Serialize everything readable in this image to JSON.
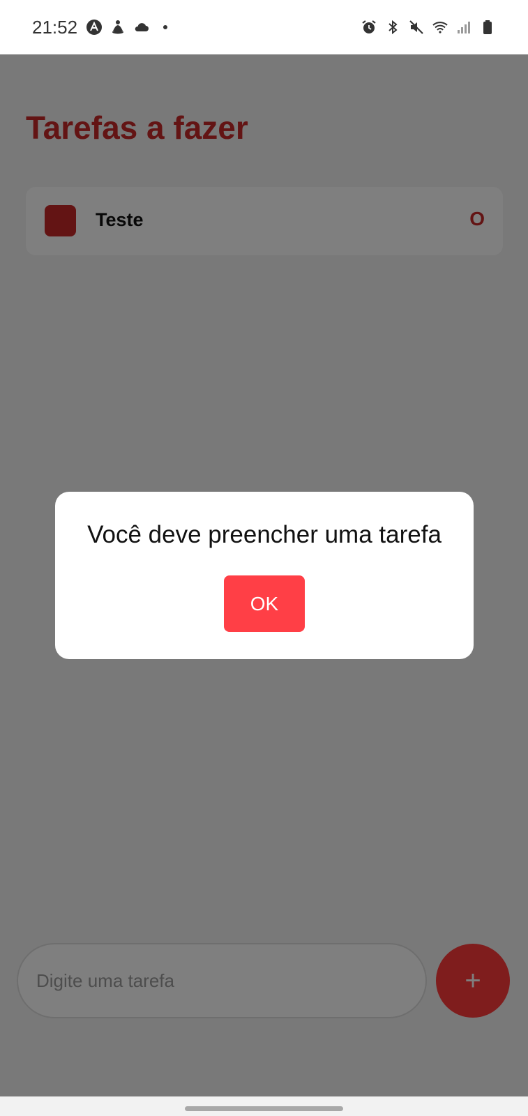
{
  "status_bar": {
    "time": "21:52",
    "left_icons": [
      "app-a-icon",
      "meditation-icon",
      "cloud-icon",
      "dot-icon"
    ],
    "right_icons": [
      "alarm-icon",
      "bluetooth-icon",
      "mute-icon",
      "wifi-icon",
      "signal-icon",
      "battery-icon"
    ]
  },
  "header": {
    "title": "Tarefas a fazer"
  },
  "tasks": [
    {
      "label": "Teste",
      "delete_label": "O"
    }
  ],
  "input": {
    "placeholder": "Digite uma tarefa",
    "value": ""
  },
  "add_button": {
    "label": "+"
  },
  "dialog": {
    "message": "Você deve preencher uma tarefa",
    "ok_label": "OK"
  },
  "colors": {
    "accent": "#ff3a3a",
    "title": "#c62828",
    "dialog_button": "#ff3f46"
  }
}
